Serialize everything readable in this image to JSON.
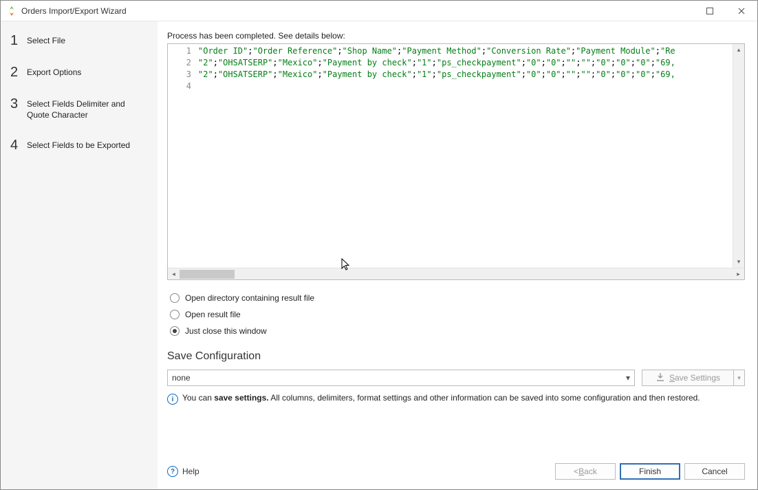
{
  "window": {
    "title": "Orders Import/Export Wizard"
  },
  "sidebar": {
    "items": [
      {
        "num": "1",
        "label": "Select File"
      },
      {
        "num": "2",
        "label": "Export Options"
      },
      {
        "num": "3",
        "label": "Select Fields Delimiter and Quote Character"
      },
      {
        "num": "4",
        "label": "Select Fields to be Exported"
      }
    ]
  },
  "main": {
    "process_label": "Process has been completed. See details below:",
    "code_lines": [
      "\"Order ID\";\"Order Reference\";\"Shop Name\";\"Payment Method\";\"Conversion Rate\";\"Payment Module\";\"Re",
      "\"2\";\"OHSATSERP\";\"Mexico\";\"Payment by check\";\"1\";\"ps_checkpayment\";\"0\";\"0\";\"\";\"\";\"0\";\"0\";\"0\";\"69,",
      "\"2\";\"OHSATSERP\";\"Mexico\";\"Payment by check\";\"1\";\"ps_checkpayment\";\"0\";\"0\";\"\";\"\";\"0\";\"0\";\"0\";\"69,",
      ""
    ],
    "radios": {
      "open_dir": "Open directory containing result file",
      "open_file": "Open result file",
      "close_win": "Just close this window",
      "selected": "close_win"
    },
    "save_config": {
      "title": "Save Configuration",
      "combo_value": "none",
      "save_btn_prefix": "S",
      "save_btn_rest": "ave Settings",
      "info_prefix": "You can ",
      "info_bold": "save settings.",
      "info_rest": " All columns, delimiters, format settings and other information can be saved into some configuration and then restored."
    }
  },
  "footer": {
    "help": "Help",
    "back_lt": "< ",
    "back_u": "B",
    "back_rest": "ack",
    "finish": "Finish",
    "cancel": "Cancel"
  }
}
